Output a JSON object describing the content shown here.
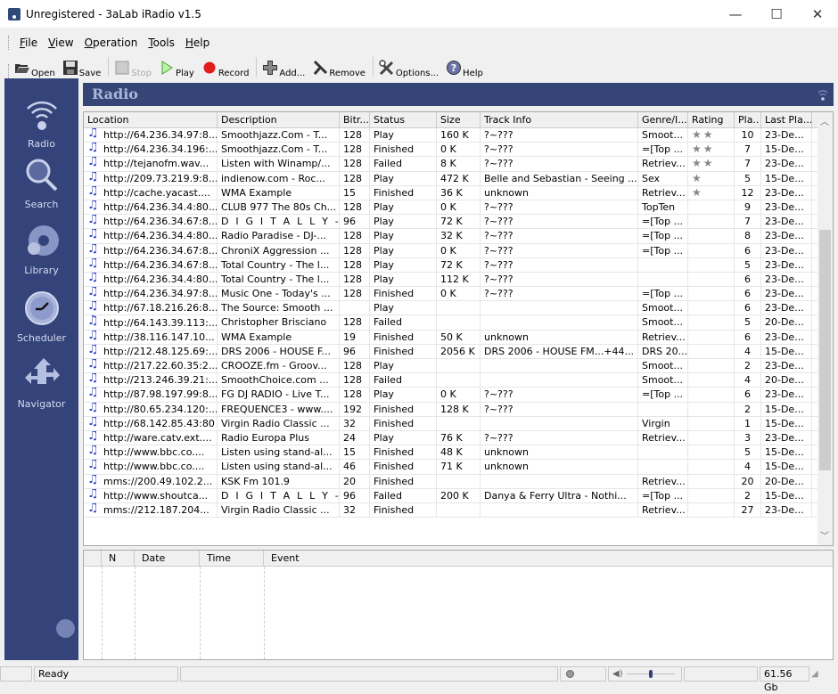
{
  "window": {
    "title": "Unregistered - 3aLab iRadio v1.5",
    "controls": {
      "minimize": "—",
      "maximize": "☐",
      "close": "✕"
    }
  },
  "menu": [
    {
      "label": "File",
      "accel": "F"
    },
    {
      "label": "View",
      "accel": "V"
    },
    {
      "label": "Operation",
      "accel": "O"
    },
    {
      "label": "Tools",
      "accel": "T"
    },
    {
      "label": "Help",
      "accel": "H"
    }
  ],
  "toolbar": [
    {
      "label": "Open",
      "icon": "folder-open-icon",
      "enabled": true
    },
    {
      "label": "Save",
      "icon": "floppy-disk-icon",
      "enabled": true
    },
    {
      "label": "Stop",
      "icon": "stop-icon",
      "enabled": false
    },
    {
      "label": "Play",
      "icon": "play-icon",
      "enabled": true
    },
    {
      "label": "Record",
      "icon": "record-icon",
      "enabled": true
    },
    {
      "label": "Add...",
      "icon": "add-icon",
      "enabled": true
    },
    {
      "label": "Remove",
      "icon": "remove-icon",
      "enabled": true
    },
    {
      "label": "Options...",
      "icon": "wrench-icon",
      "enabled": true
    },
    {
      "label": "Help",
      "icon": "help-icon",
      "enabled": true
    }
  ],
  "sidebar": [
    {
      "label": "Radio",
      "icon": "radio-broadcast-icon"
    },
    {
      "label": "Search",
      "icon": "magnifier-icon"
    },
    {
      "label": "Library",
      "icon": "disc-library-icon"
    },
    {
      "label": "Scheduler",
      "icon": "clock-icon"
    },
    {
      "label": "Navigator",
      "icon": "navigator-arrows-icon"
    }
  ],
  "panel": {
    "title": "Radio"
  },
  "columns": [
    "Location",
    "Description",
    "Bitr...",
    "Status",
    "Size",
    "Track Info",
    "Genre/I...",
    "Rating",
    "Pla..",
    "Last Pla..."
  ],
  "rows": [
    {
      "location": "http://64.236.34.97:8...",
      "description": "Smoothjazz.Com - T...",
      "bitrate": "128",
      "status": "Play",
      "size": "160 K",
      "track": "?~???",
      "genre": "Smoot...",
      "rating": 2,
      "plays": "10",
      "last": "23-De..."
    },
    {
      "location": "http://64.236.34.196:...",
      "description": "Smoothjazz.Com - T...",
      "bitrate": "128",
      "status": "Finished",
      "size": "0 K",
      "track": "?~???",
      "genre": "=[Top ...",
      "rating": 2,
      "plays": "7",
      "last": "15-De..."
    },
    {
      "location": "http://tejanofm.wav...",
      "description": "Listen with Winamp/...",
      "bitrate": "128",
      "status": "Failed",
      "size": "8 K",
      "track": "?~???",
      "genre": "Retriev...",
      "rating": 2,
      "plays": "7",
      "last": "23-De..."
    },
    {
      "location": "http://209.73.219.9:8...",
      "description": "indienow.com - Roc...",
      "bitrate": "128",
      "status": "Play",
      "size": "472 K",
      "track": "Belle and Sebastian - Seeing ...",
      "genre": "Sex",
      "rating": 1,
      "plays": "5",
      "last": "15-De..."
    },
    {
      "location": "http://cache.yacast....",
      "description": "WMA Example",
      "bitrate": "15",
      "status": "Finished",
      "size": "36 K",
      "track": "unknown",
      "genre": "Retriev...",
      "rating": 1,
      "plays": "12",
      "last": "23-De..."
    },
    {
      "location": "http://64.236.34.4:80...",
      "description": "CLUB 977 The 80s Ch...",
      "bitrate": "128",
      "status": "Play",
      "size": "0 K",
      "track": "?~???",
      "genre": "TopTen",
      "rating": 0,
      "plays": "9",
      "last": "23-De..."
    },
    {
      "location": "http://64.236.34.67:8...",
      "description": "D I G I T A L L Y - I M ...",
      "bitrate": "96",
      "status": "Play",
      "size": "72 K",
      "track": "?~???",
      "genre": "=[Top ...",
      "rating": 0,
      "plays": "7",
      "last": "23-De..."
    },
    {
      "location": "http://64.236.34.4:80...",
      "description": "Radio Paradise - DJ-...",
      "bitrate": "128",
      "status": "Play",
      "size": "32 K",
      "track": "?~???",
      "genre": "=[Top ...",
      "rating": 0,
      "plays": "8",
      "last": "23-De..."
    },
    {
      "location": "http://64.236.34.67:8...",
      "description": "ChroniX Aggression ...",
      "bitrate": "128",
      "status": "Play",
      "size": "0 K",
      "track": "?~???",
      "genre": "=[Top ...",
      "rating": 0,
      "plays": "6",
      "last": "23-De..."
    },
    {
      "location": "http://64.236.34.67:8...",
      "description": "Total Country - The l...",
      "bitrate": "128",
      "status": "Play",
      "size": "72 K",
      "track": "?~???",
      "genre": "",
      "rating": 0,
      "plays": "5",
      "last": "23-De..."
    },
    {
      "location": "http://64.236.34.4:80...",
      "description": "Total Country - The l...",
      "bitrate": "128",
      "status": "Play",
      "size": "112 K",
      "track": "?~???",
      "genre": "",
      "rating": 0,
      "plays": "6",
      "last": "23-De..."
    },
    {
      "location": "http://64.236.34.97:8...",
      "description": "Music One - Today's ...",
      "bitrate": "128",
      "status": "Finished",
      "size": "0 K",
      "track": "?~???",
      "genre": "=[Top ...",
      "rating": 0,
      "plays": "6",
      "last": "23-De..."
    },
    {
      "location": "http://67.18.216.26:8...",
      "description": "The Source: Smooth ...",
      "bitrate": "",
      "status": "Play",
      "size": "",
      "track": "",
      "genre": "Smoot...",
      "rating": 0,
      "plays": "6",
      "last": "23-De..."
    },
    {
      "location": "http://64.143.39.113:...",
      "description": "Christopher Brisciano",
      "bitrate": "128",
      "status": "Failed",
      "size": "",
      "track": "",
      "genre": "Smoot...",
      "rating": 0,
      "plays": "5",
      "last": "20-De..."
    },
    {
      "location": "http://38.116.147.10...",
      "description": "WMA Example",
      "bitrate": "19",
      "status": "Finished",
      "size": "50 K",
      "track": "unknown",
      "genre": "Retriev...",
      "rating": 0,
      "plays": "6",
      "last": "23-De..."
    },
    {
      "location": "http://212.48.125.69:...",
      "description": "DRS 2006 - HOUSE F...",
      "bitrate": "96",
      "status": "Finished",
      "size": "2056 K",
      "track": "DRS 2006 - HOUSE FM...+44...",
      "genre": "DRS 20...",
      "rating": 0,
      "plays": "4",
      "last": "15-De..."
    },
    {
      "location": "http://217.22.60.35:2...",
      "description": "CROOZE.fm - Groov...",
      "bitrate": "128",
      "status": "Play",
      "size": "",
      "track": "",
      "genre": "Smoot...",
      "rating": 0,
      "plays": "2",
      "last": "23-De..."
    },
    {
      "location": "http://213.246.39.21:...",
      "description": "SmoothChoice.com ...",
      "bitrate": "128",
      "status": "Failed",
      "size": "",
      "track": "",
      "genre": "Smoot...",
      "rating": 0,
      "plays": "4",
      "last": "20-De..."
    },
    {
      "location": "http://87.98.197.99:8...",
      "description": "FG DJ RADIO - Live T...",
      "bitrate": "128",
      "status": "Play",
      "size": "0 K",
      "track": "?~???",
      "genre": "=[Top ...",
      "rating": 0,
      "plays": "6",
      "last": "23-De..."
    },
    {
      "location": "http://80.65.234.120:...",
      "description": "FREQUENCE3 - www....",
      "bitrate": "192",
      "status": "Finished",
      "size": "128 K",
      "track": "?~???",
      "genre": "",
      "rating": 0,
      "plays": "2",
      "last": "15-De..."
    },
    {
      "location": "http://68.142.85.43:80",
      "description": "Virgin Radio Classic ...",
      "bitrate": "32",
      "status": "Finished",
      "size": "",
      "track": "",
      "genre": "Virgin",
      "rating": 0,
      "plays": "1",
      "last": "15-De..."
    },
    {
      "location": "http://ware.catv.ext....",
      "description": "Radio Europa Plus",
      "bitrate": "24",
      "status": "Play",
      "size": "76 K",
      "track": "?~???",
      "genre": "Retriev...",
      "rating": 0,
      "plays": "3",
      "last": "23-De..."
    },
    {
      "location": "http://www.bbc.co....",
      "description": "Listen using stand-al...",
      "bitrate": "15",
      "status": "Finished",
      "size": "48 K",
      "track": "unknown",
      "genre": "",
      "rating": 0,
      "plays": "5",
      "last": "15-De..."
    },
    {
      "location": "http://www.bbc.co....",
      "description": "Listen using stand-al...",
      "bitrate": "46",
      "status": "Finished",
      "size": "71 K",
      "track": "unknown",
      "genre": "",
      "rating": 0,
      "plays": "4",
      "last": "15-De..."
    },
    {
      "location": "mms://200.49.102.2...",
      "description": "KSK Fm 101.9",
      "bitrate": "20",
      "status": "Finished",
      "size": "",
      "track": "",
      "genre": "Retriev...",
      "rating": 0,
      "plays": "20",
      "last": "20-De..."
    },
    {
      "location": "http://www.shoutca...",
      "description": "D I G I T A L L Y - I M ...",
      "bitrate": "96",
      "status": "Failed",
      "size": "200 K",
      "track": "Danya & Ferry Ultra - Nothi...",
      "genre": "=[Top ...",
      "rating": 0,
      "plays": "2",
      "last": "15-De..."
    },
    {
      "location": "mms://212.187.204...",
      "description": "Virgin Radio Classic ...",
      "bitrate": "32",
      "status": "Finished",
      "size": "",
      "track": "",
      "genre": "Retriev...",
      "rating": 0,
      "plays": "27",
      "last": "23-De..."
    }
  ],
  "log": {
    "columns": [
      "N",
      "Date",
      "Time",
      "Event"
    ]
  },
  "status": {
    "text": "Ready",
    "disk": "61.56 Gb",
    "volume_percent": 50
  }
}
